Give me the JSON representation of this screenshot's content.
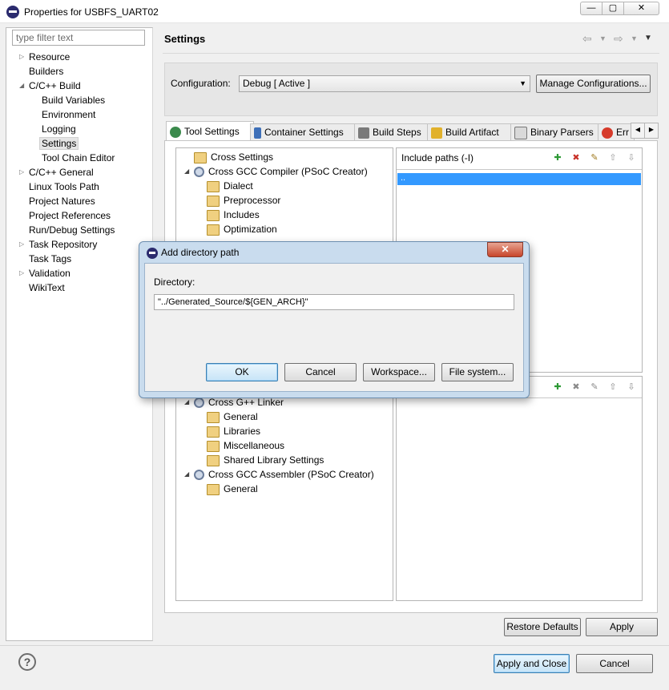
{
  "window": {
    "title": "Properties for USBFS_UART02",
    "minimize_glyph": "—",
    "maximize_glyph": "▢",
    "close_glyph": "✕"
  },
  "filter": {
    "placeholder": "type filter text"
  },
  "nav": {
    "items": [
      {
        "label": "Resource"
      },
      {
        "label": "Builders"
      },
      {
        "label": "C/C++ Build"
      },
      {
        "label": "Build Variables"
      },
      {
        "label": "Environment"
      },
      {
        "label": "Logging"
      },
      {
        "label": "Settings"
      },
      {
        "label": "Tool Chain Editor"
      },
      {
        "label": "C/C++ General"
      },
      {
        "label": "Linux Tools Path"
      },
      {
        "label": "Project Natures"
      },
      {
        "label": "Project References"
      },
      {
        "label": "Run/Debug Settings"
      },
      {
        "label": "Task Repository"
      },
      {
        "label": "Task Tags"
      },
      {
        "label": "Validation"
      },
      {
        "label": "WikiText"
      }
    ],
    "selected": "Settings"
  },
  "header": {
    "title": "Settings"
  },
  "config": {
    "label": "Configuration:",
    "selected": "Debug  [ Active ]",
    "manage_button": "Manage Configurations..."
  },
  "tabs": [
    {
      "label": "Tool Settings",
      "icon": "tool-settings-icon",
      "active": true
    },
    {
      "label": "Container Settings",
      "icon": "container-icon"
    },
    {
      "label": "Build Steps",
      "icon": "build-steps-icon"
    },
    {
      "label": "Build Artifact",
      "icon": "trophy-icon"
    },
    {
      "label": "Binary Parsers",
      "icon": "binary-icon"
    },
    {
      "label": "Err",
      "icon": "error-icon"
    }
  ],
  "tree": {
    "items": [
      {
        "label": "Cross Settings"
      },
      {
        "label": "Cross GCC Compiler (PSoC Creator)"
      },
      {
        "label": "Dialect"
      },
      {
        "label": "Preprocessor"
      },
      {
        "label": "Includes"
      },
      {
        "label": "Optimization"
      },
      {
        "label": "Cross G++ Linker"
      },
      {
        "label": "General"
      },
      {
        "label": "Libraries"
      },
      {
        "label": "Miscellaneous"
      },
      {
        "label": "Shared Library Settings"
      },
      {
        "label": "Cross GCC Assembler (PSoC Creator)"
      },
      {
        "label": "General"
      }
    ]
  },
  "include": {
    "label": "Include paths (-I)",
    "rows": [
      ".."
    ]
  },
  "buttons": {
    "restore_defaults": "Restore Defaults",
    "apply": "Apply",
    "apply_and_close": "Apply and Close",
    "cancel": "Cancel",
    "help": "?"
  },
  "dialog": {
    "title": "Add directory path",
    "close_glyph": "✕",
    "directory_label": "Directory:",
    "directory_value": "\"../Generated_Source/${GEN_ARCH}\"",
    "ok": "OK",
    "cancel": "Cancel",
    "workspace": "Workspace...",
    "file_system": "File system..."
  }
}
